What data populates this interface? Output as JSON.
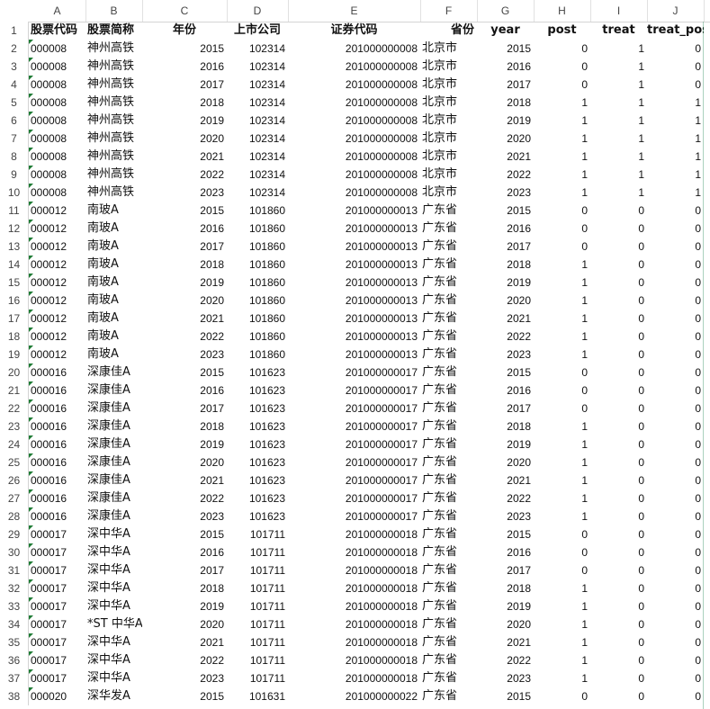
{
  "columns": [
    "A",
    "B",
    "C",
    "D",
    "E",
    "F",
    "G",
    "H",
    "I",
    "J"
  ],
  "header": [
    "股票代码",
    "股票简称",
    "年份",
    "上市公司",
    "证券代码",
    "省份",
    "year",
    "post",
    "treat",
    "treat_post"
  ],
  "rows": [
    [
      "000008",
      "神州高铁",
      "2015",
      "102314",
      "201000000008",
      "北京市",
      "2015",
      "0",
      "1",
      "0"
    ],
    [
      "000008",
      "神州高铁",
      "2016",
      "102314",
      "201000000008",
      "北京市",
      "2016",
      "0",
      "1",
      "0"
    ],
    [
      "000008",
      "神州高铁",
      "2017",
      "102314",
      "201000000008",
      "北京市",
      "2017",
      "0",
      "1",
      "0"
    ],
    [
      "000008",
      "神州高铁",
      "2018",
      "102314",
      "201000000008",
      "北京市",
      "2018",
      "1",
      "1",
      "1"
    ],
    [
      "000008",
      "神州高铁",
      "2019",
      "102314",
      "201000000008",
      "北京市",
      "2019",
      "1",
      "1",
      "1"
    ],
    [
      "000008",
      "神州高铁",
      "2020",
      "102314",
      "201000000008",
      "北京市",
      "2020",
      "1",
      "1",
      "1"
    ],
    [
      "000008",
      "神州高铁",
      "2021",
      "102314",
      "201000000008",
      "北京市",
      "2021",
      "1",
      "1",
      "1"
    ],
    [
      "000008",
      "神州高铁",
      "2022",
      "102314",
      "201000000008",
      "北京市",
      "2022",
      "1",
      "1",
      "1"
    ],
    [
      "000008",
      "神州高铁",
      "2023",
      "102314",
      "201000000008",
      "北京市",
      "2023",
      "1",
      "1",
      "1"
    ],
    [
      "000012",
      "南玻A",
      "2015",
      "101860",
      "201000000013",
      "广东省",
      "2015",
      "0",
      "0",
      "0"
    ],
    [
      "000012",
      "南玻A",
      "2016",
      "101860",
      "201000000013",
      "广东省",
      "2016",
      "0",
      "0",
      "0"
    ],
    [
      "000012",
      "南玻A",
      "2017",
      "101860",
      "201000000013",
      "广东省",
      "2017",
      "0",
      "0",
      "0"
    ],
    [
      "000012",
      "南玻A",
      "2018",
      "101860",
      "201000000013",
      "广东省",
      "2018",
      "1",
      "0",
      "0"
    ],
    [
      "000012",
      "南玻A",
      "2019",
      "101860",
      "201000000013",
      "广东省",
      "2019",
      "1",
      "0",
      "0"
    ],
    [
      "000012",
      "南玻A",
      "2020",
      "101860",
      "201000000013",
      "广东省",
      "2020",
      "1",
      "0",
      "0"
    ],
    [
      "000012",
      "南玻A",
      "2021",
      "101860",
      "201000000013",
      "广东省",
      "2021",
      "1",
      "0",
      "0"
    ],
    [
      "000012",
      "南玻A",
      "2022",
      "101860",
      "201000000013",
      "广东省",
      "2022",
      "1",
      "0",
      "0"
    ],
    [
      "000012",
      "南玻A",
      "2023",
      "101860",
      "201000000013",
      "广东省",
      "2023",
      "1",
      "0",
      "0"
    ],
    [
      "000016",
      "深康佳A",
      "2015",
      "101623",
      "201000000017",
      "广东省",
      "2015",
      "0",
      "0",
      "0"
    ],
    [
      "000016",
      "深康佳A",
      "2016",
      "101623",
      "201000000017",
      "广东省",
      "2016",
      "0",
      "0",
      "0"
    ],
    [
      "000016",
      "深康佳A",
      "2017",
      "101623",
      "201000000017",
      "广东省",
      "2017",
      "0",
      "0",
      "0"
    ],
    [
      "000016",
      "深康佳A",
      "2018",
      "101623",
      "201000000017",
      "广东省",
      "2018",
      "1",
      "0",
      "0"
    ],
    [
      "000016",
      "深康佳A",
      "2019",
      "101623",
      "201000000017",
      "广东省",
      "2019",
      "1",
      "0",
      "0"
    ],
    [
      "000016",
      "深康佳A",
      "2020",
      "101623",
      "201000000017",
      "广东省",
      "2020",
      "1",
      "0",
      "0"
    ],
    [
      "000016",
      "深康佳A",
      "2021",
      "101623",
      "201000000017",
      "广东省",
      "2021",
      "1",
      "0",
      "0"
    ],
    [
      "000016",
      "深康佳A",
      "2022",
      "101623",
      "201000000017",
      "广东省",
      "2022",
      "1",
      "0",
      "0"
    ],
    [
      "000016",
      "深康佳A",
      "2023",
      "101623",
      "201000000017",
      "广东省",
      "2023",
      "1",
      "0",
      "0"
    ],
    [
      "000017",
      "深中华A",
      "2015",
      "101711",
      "201000000018",
      "广东省",
      "2015",
      "0",
      "0",
      "0"
    ],
    [
      "000017",
      "深中华A",
      "2016",
      "101711",
      "201000000018",
      "广东省",
      "2016",
      "0",
      "0",
      "0"
    ],
    [
      "000017",
      "深中华A",
      "2017",
      "101711",
      "201000000018",
      "广东省",
      "2017",
      "0",
      "0",
      "0"
    ],
    [
      "000017",
      "深中华A",
      "2018",
      "101711",
      "201000000018",
      "广东省",
      "2018",
      "1",
      "0",
      "0"
    ],
    [
      "000017",
      "深中华A",
      "2019",
      "101711",
      "201000000018",
      "广东省",
      "2019",
      "1",
      "0",
      "0"
    ],
    [
      "000017",
      "*ST 中华A",
      "2020",
      "101711",
      "201000000018",
      "广东省",
      "2020",
      "1",
      "0",
      "0"
    ],
    [
      "000017",
      "深中华A",
      "2021",
      "101711",
      "201000000018",
      "广东省",
      "2021",
      "1",
      "0",
      "0"
    ],
    [
      "000017",
      "深中华A",
      "2022",
      "101711",
      "201000000018",
      "广东省",
      "2022",
      "1",
      "0",
      "0"
    ],
    [
      "000017",
      "深中华A",
      "2023",
      "101711",
      "201000000018",
      "广东省",
      "2023",
      "1",
      "0",
      "0"
    ],
    [
      "000020",
      "深华发A",
      "2015",
      "101631",
      "201000000022",
      "广东省",
      "2015",
      "0",
      "0",
      "0"
    ]
  ],
  "colors": {
    "header_line": "#d4d4d4",
    "text_indicator": "#1e7b34",
    "grid_green": "#0f7b45"
  }
}
